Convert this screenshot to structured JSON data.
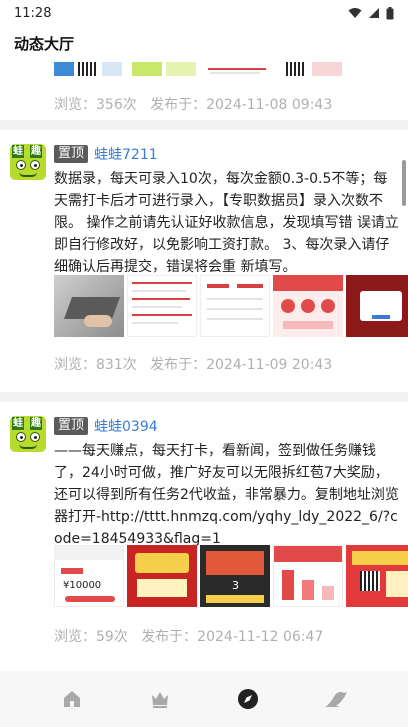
{
  "status_bar": {
    "time": "11:28"
  },
  "header": {
    "title": "动态大厅"
  },
  "posts": [
    {
      "views_label": "浏览：356次",
      "published_label": "发布于：2024-11-08 09:43"
    },
    {
      "pin_label": "置顶",
      "author": "蛙蛙7211",
      "body": "数据录，每天可录入10次，每次金额0.3-0.5不等；每天需打卡后才可进行录入，【专职数据员】录入次数不限。 操作之前请先认证好收款信息，发现填写错 误请立即自行修改好，以免影响工资打款。 3、每次录入请仔细确认后再提交，错误将会重 新填写。",
      "views_label": "浏览：831次",
      "published_label": "发布于：2024-11-09 20:43"
    },
    {
      "pin_label": "置顶",
      "author": "蛙蛙0394",
      "body": "——每天赚点，每天打卡，看新闻，签到做任务赚钱了，24小时可做，推广好友可以无限拆红苞7大奖励，还可以得到所有任务2代收益，非常暴力。复制地址浏览器打开-http://tttt.hnmzq.com/yqhy_ldy_2022_6/?code=18454933&flag=1",
      "views_label": "浏览：59次",
      "published_label": "发布于：2024-11-12 06:47",
      "thumb_text": {
        "amount": "¥10000",
        "badge": "3"
      }
    }
  ],
  "avatar_text": [
    "蛙",
    "趣"
  ],
  "nav": {
    "items": [
      {
        "icon": "home-icon"
      },
      {
        "icon": "crown-icon"
      },
      {
        "icon": "compass-icon"
      },
      {
        "icon": "frog-icon"
      }
    ]
  },
  "colors": {
    "author_link": "#3a7bd5",
    "meta_text": "#b0b0b0",
    "pin_badge": "#5b5b5b",
    "nav_active": "#222222",
    "nav_inactive": "#a8a8a8"
  }
}
